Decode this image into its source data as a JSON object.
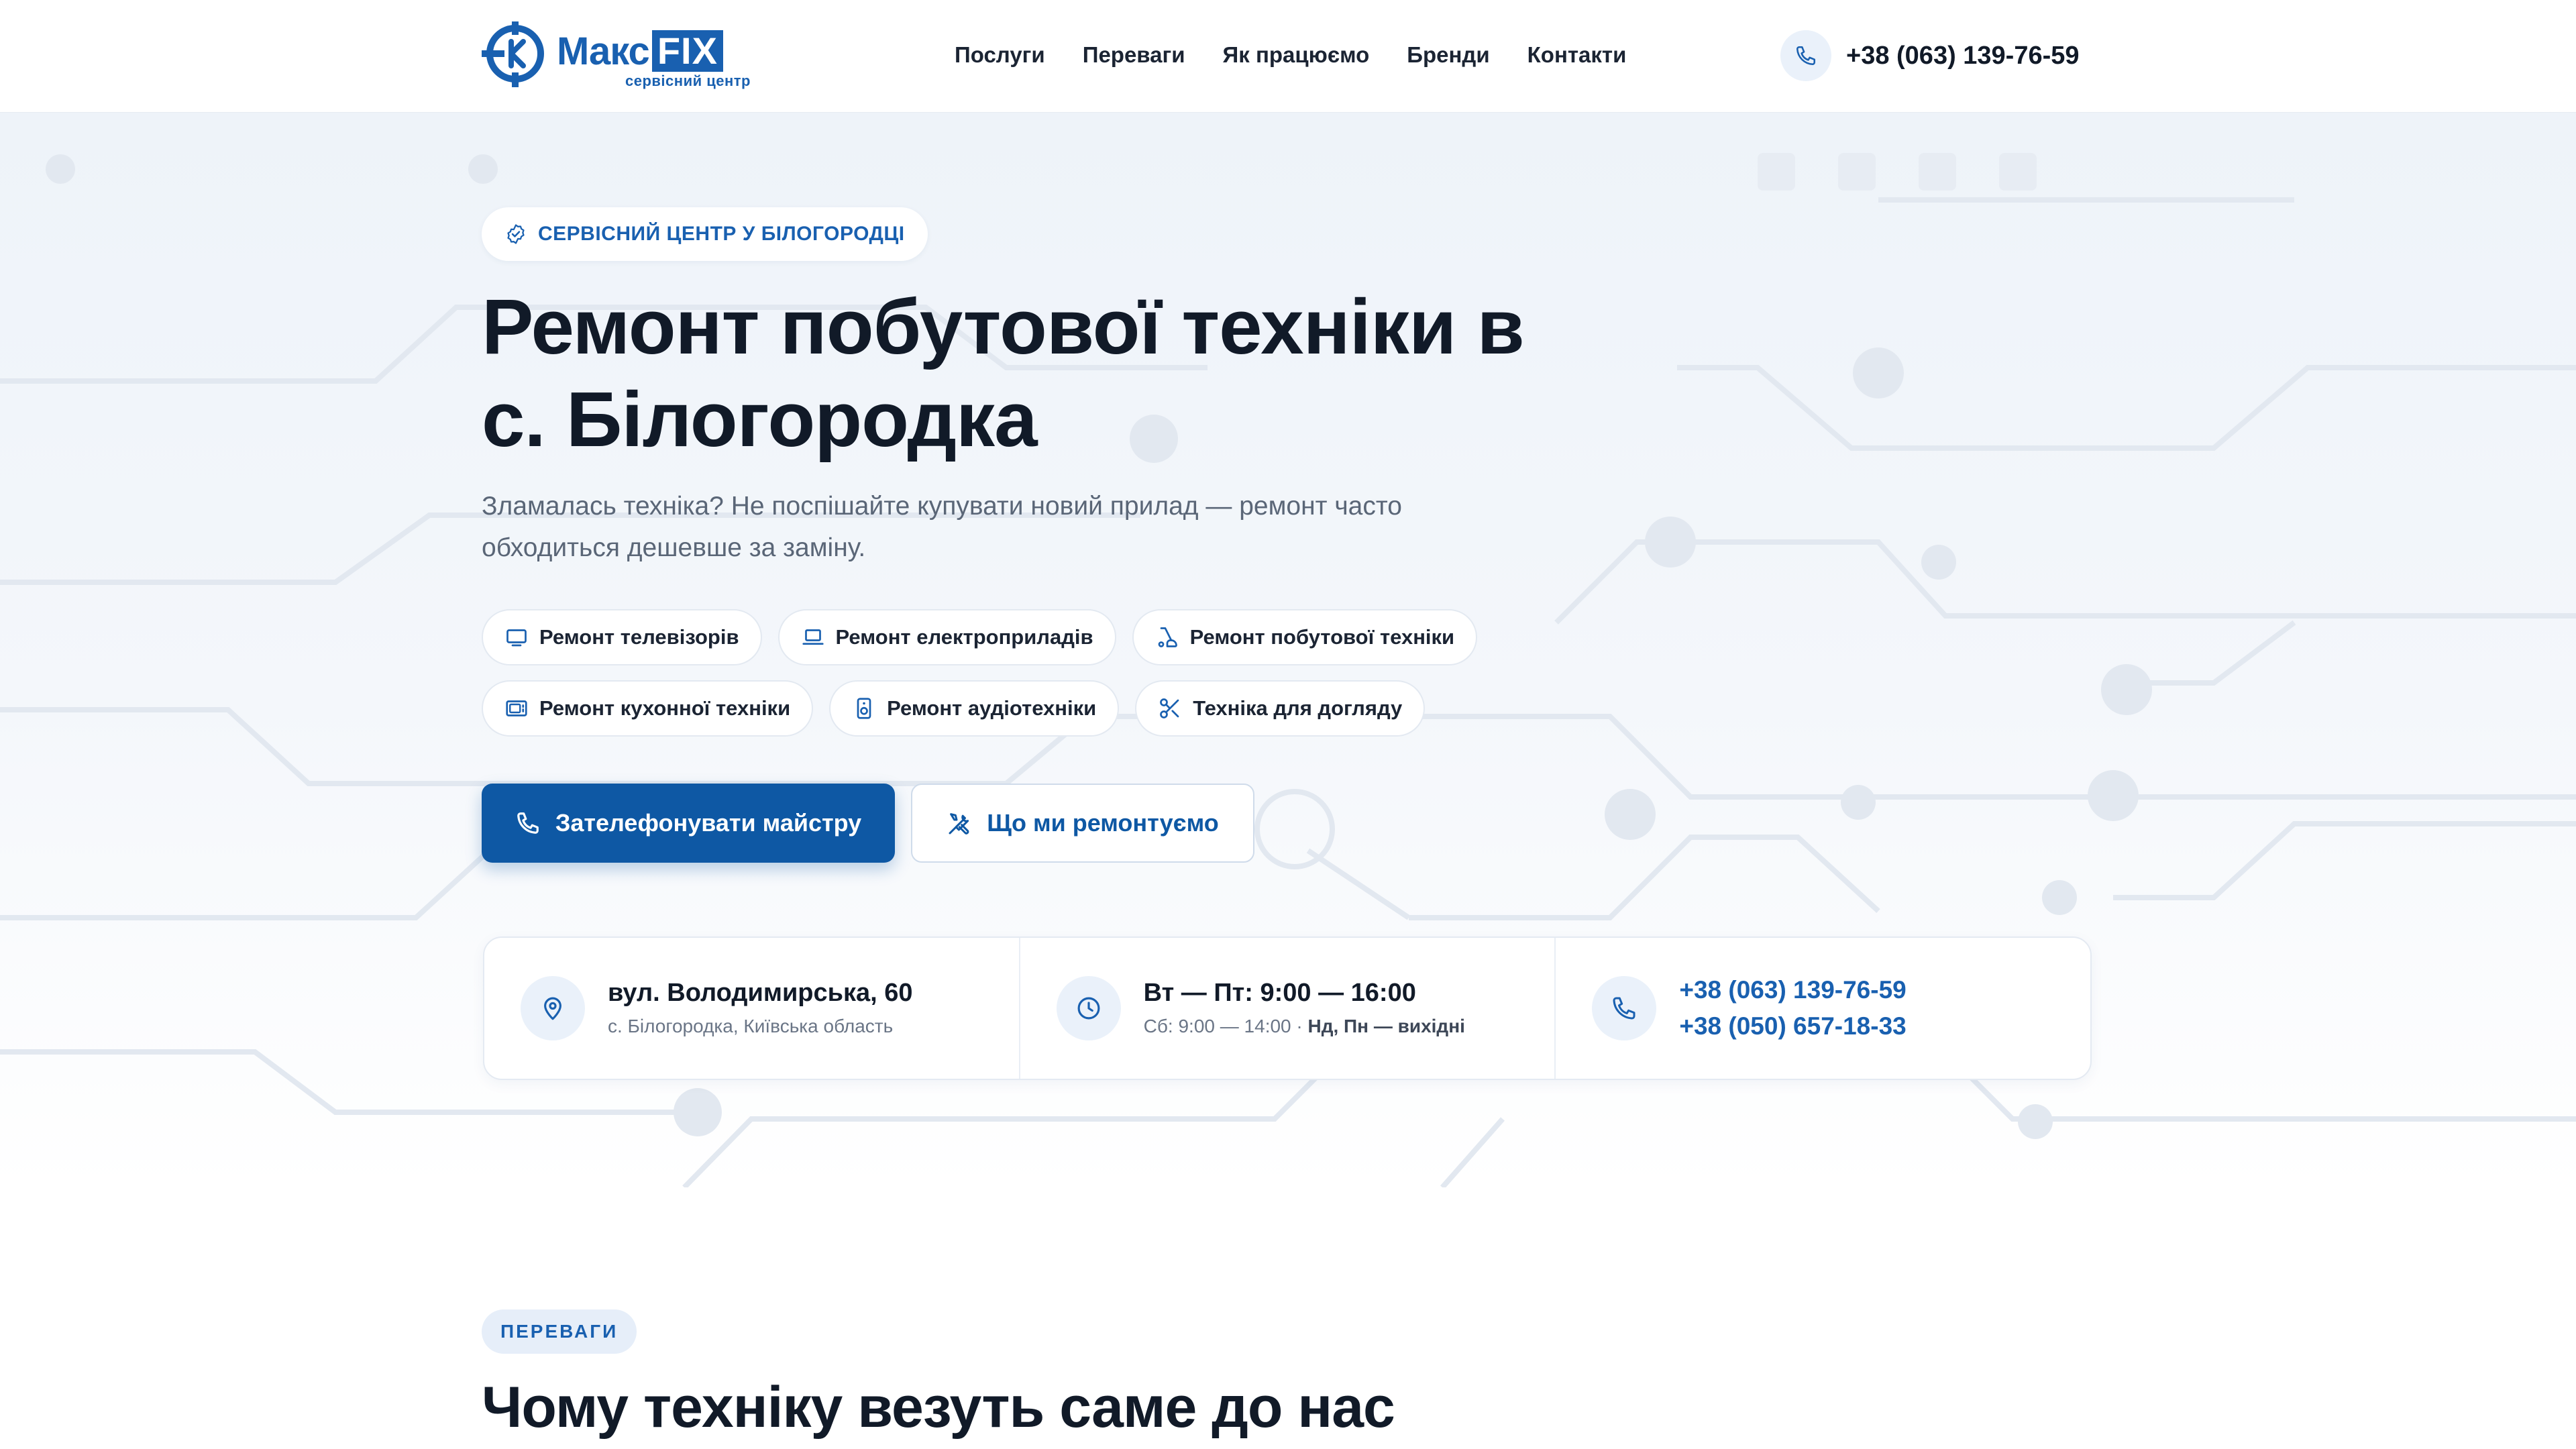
{
  "header": {
    "logo": {
      "word_left": "Макс",
      "word_right": "FIX",
      "tagline": "сервісний центр"
    },
    "nav": [
      {
        "label": "Послуги"
      },
      {
        "label": "Переваги"
      },
      {
        "label": "Як працюємо"
      },
      {
        "label": "Бренди"
      },
      {
        "label": "Контакти"
      }
    ],
    "phone": "+38 (063) 139-76-59"
  },
  "hero": {
    "badge": "СЕРВІСНИЙ ЦЕНТР У БІЛОГОРОДЦІ",
    "title_line1": "Ремонт побутової техніки в",
    "title_line2": "с. Білогородка",
    "subtitle_line1": "Зламалась техніка? Не поспішайте купувати новий прилад — ремонт часто",
    "subtitle_line2": "обходиться дешевше за заміну.",
    "chips_row1": [
      {
        "label": "Ремонт телевізорів",
        "icon": "tv-icon"
      },
      {
        "label": "Ремонт електроприладів",
        "icon": "laptop-icon"
      },
      {
        "label": "Ремонт побутової техніки",
        "icon": "vacuum-icon"
      }
    ],
    "chips_row2": [
      {
        "label": "Ремонт кухонної техніки",
        "icon": "microwave-icon"
      },
      {
        "label": "Ремонт аудіотехніки",
        "icon": "speaker-icon"
      },
      {
        "label": "Техніка для догляду",
        "icon": "scissors-icon"
      }
    ],
    "cta_primary": "Зателефонувати майстру",
    "cta_secondary": "Що ми ремонтуємо"
  },
  "info": {
    "address_main": "вул. Володимирська, 60",
    "address_sub": "с. Білогородка, Київська область",
    "hours_main": "Вт — Пт: 9:00 — 16:00",
    "hours_sub_regular": "Сб: 9:00 — 14:00 · ",
    "hours_sub_bold": "Нд, Пн — вихідні",
    "phone1": "+38 (063) 139-76-59",
    "phone2": "+38 (050) 657-18-33"
  },
  "advantages": {
    "badge": "ПЕРЕВАГИ",
    "title": "Чому техніку везуть саме до нас"
  },
  "colors": {
    "brand": "#1960b0",
    "primary_button": "#0e58a4",
    "text_dark": "#111a28",
    "text_muted": "#5a6677"
  }
}
